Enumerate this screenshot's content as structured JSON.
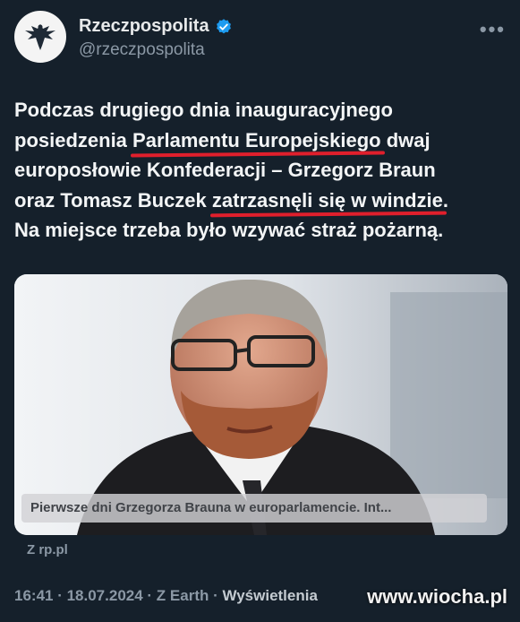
{
  "author": {
    "name": "Rzeczpospolita",
    "handle": "@rzeczpospolita",
    "verified": true,
    "avatar_icon": "eagle-logo"
  },
  "more_label": "•••",
  "tweet": {
    "line1": "Podczas drugiego dnia inauguracyjnego",
    "line2_pre": "posiedzenia ",
    "line2_underlined": "Parlamentu Europejskiego",
    "line2_post": " dwaj",
    "line3": "europosłowie Konfederacji – Grzegorz Braun",
    "line4_pre": "oraz Tomasz Buczek ",
    "line4_underlined": "zatrzasnęli się w windzie",
    "line4_post": ".",
    "line5": "Na miejsce trzeba było wzywać straż pożarną."
  },
  "card": {
    "caption": "Pierwsze dni Grzegorza Brauna w europarlamencie. Int...",
    "source": "Z rp.pl"
  },
  "meta": {
    "time": "16:41",
    "date": "18.07.2024",
    "client": "Z Earth",
    "views_label": "Wyświetlenia",
    "separator": " · "
  },
  "watermark": "www.wiocha.pl",
  "colors": {
    "background": "#15202b",
    "underline": "#e01f2c",
    "verified": "#1d9bf0"
  }
}
